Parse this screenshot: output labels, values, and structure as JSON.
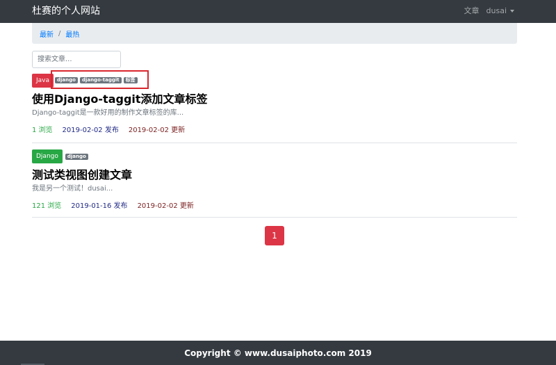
{
  "navbar": {
    "brand": "杜赛的个人网站",
    "article_link": "文章",
    "user": "dusai"
  },
  "breadcrumb": {
    "latest": "最新",
    "separator": "/",
    "hottest": "最热"
  },
  "search": {
    "placeholder": "搜索文章..."
  },
  "articles": [
    {
      "column": "Java",
      "column_color": "#dc3545",
      "tags": [
        "django",
        "django-taggit",
        "标签"
      ],
      "title": "使用Django-taggit添加文章标签",
      "summary": "Django-taggit是一款好用的制作文章标签的库...",
      "views": "1 浏览",
      "published": "2019-02-02 发布",
      "updated": "2019-02-02 更新"
    },
    {
      "column": "Django",
      "column_color": "#28a745",
      "tags": [
        "django"
      ],
      "title": "测试类视图创建文章",
      "summary": "我是另一个测试！dusai...",
      "views": "121 浏览",
      "published": "2019-01-16 发布",
      "updated": "2019-02-02 更新"
    }
  ],
  "pagination": {
    "current": "1"
  },
  "footer": {
    "copyright": "Copyright © www.dusaiphoto.com 2019"
  },
  "colors": {
    "navbar_bg": "#343a40",
    "highlight_box": "#d9262d",
    "page_active": "#dc3545"
  }
}
